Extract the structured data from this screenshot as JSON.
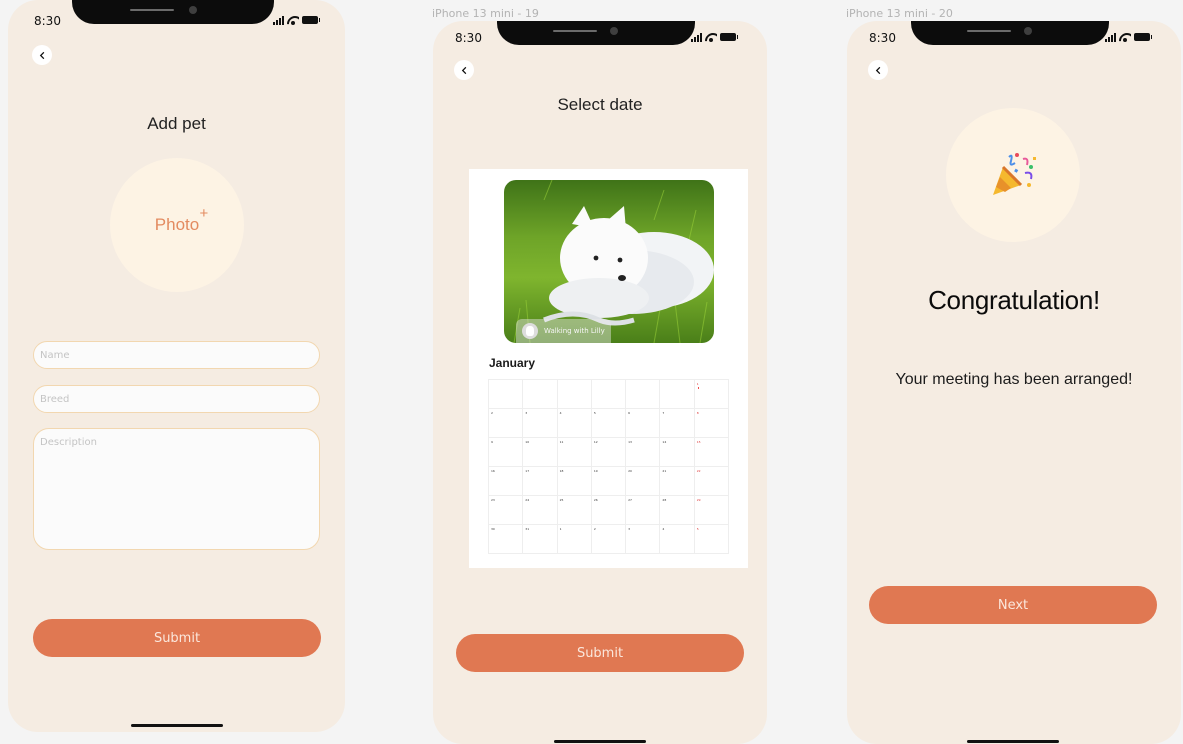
{
  "screens": [
    {
      "frame_label": "",
      "time": "8:30",
      "title": "Add pet",
      "photo_label": "Photo",
      "photo_plus": "+",
      "fields": {
        "name_placeholder": "Name",
        "breed_placeholder": "Breed",
        "description_placeholder": "Description"
      },
      "button": "Submit"
    },
    {
      "frame_label": "iPhone 13 mini - 19",
      "time": "8:30",
      "title": "Select date",
      "photo_caption": "Walking with Lilly",
      "month": "January",
      "calendar": {
        "weekdays": [
          "",
          "",
          "",
          "",
          "",
          "",
          ""
        ],
        "days": [
          "",
          "",
          "",
          "",
          "",
          "",
          "1",
          "2",
          "3",
          "4",
          "5",
          "6",
          "7",
          "8",
          "9",
          "10",
          "11",
          "12",
          "13",
          "14",
          "15",
          "16",
          "17",
          "18",
          "19",
          "20",
          "21",
          "22",
          "23",
          "24",
          "25",
          "26",
          "27",
          "28",
          "29",
          "30",
          "31",
          "1",
          "2",
          "3",
          "4",
          "5",
          "6",
          "7"
        ]
      },
      "button": "Submit"
    },
    {
      "frame_label": "iPhone 13 mini - 20",
      "time": "8:30",
      "heading": "Congratulation!",
      "message": "Your meeting has been arranged!",
      "button": "Next"
    }
  ],
  "icons": [
    "back-chevron-icon",
    "signal-icon",
    "wifi-icon",
    "battery-icon",
    "party-popper-icon"
  ],
  "colors": {
    "phone_bg": "#f5ece2",
    "accent": "#e07852",
    "accent_text": "#fbe7dc",
    "photo_circle": "#fdf3e4",
    "field_border": "#f2d7b0",
    "canvas": "#f4f4f4"
  }
}
